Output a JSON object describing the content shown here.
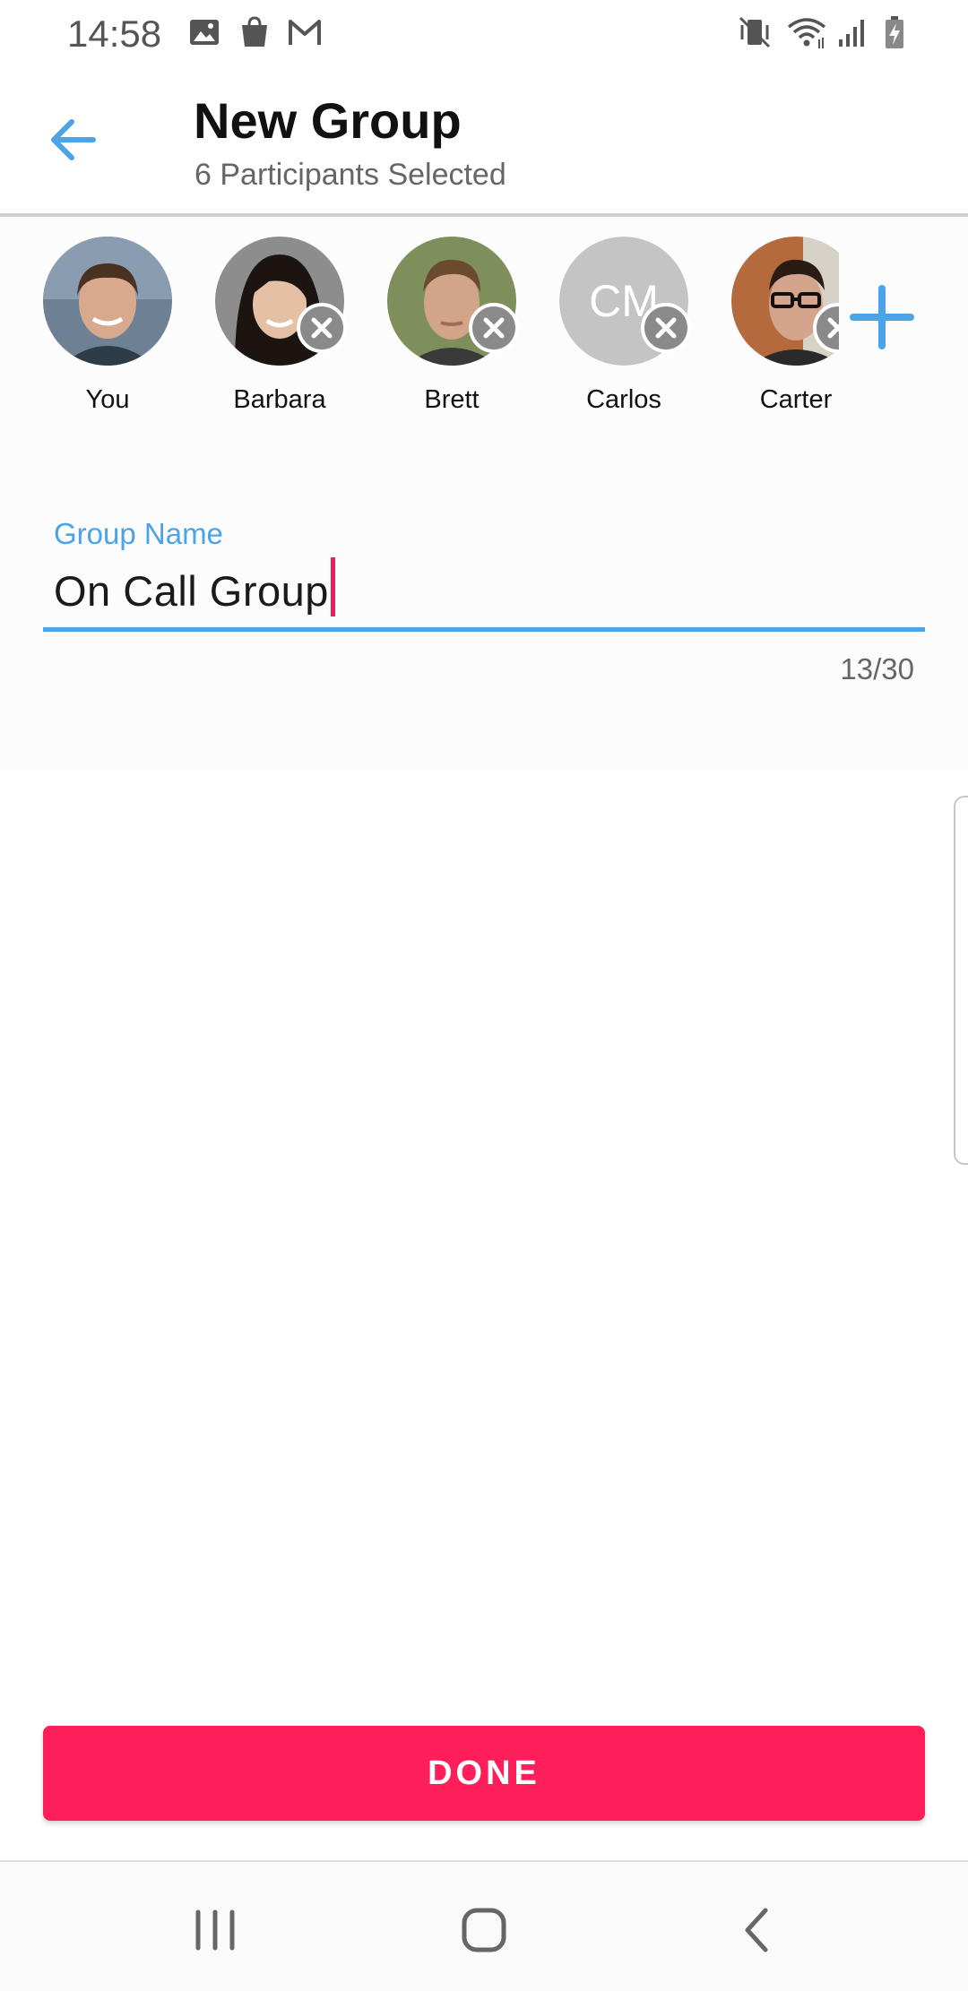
{
  "status_bar": {
    "time": "14:58",
    "left_icons": [
      "gallery-icon",
      "shopping-bag-icon",
      "gmail-icon"
    ],
    "right_icons": [
      "vibrate-mute-icon",
      "wifi-icon",
      "signal-icon",
      "battery-charging-icon"
    ]
  },
  "header": {
    "title": "New Group",
    "subtitle": "6 Participants Selected",
    "back_icon": "arrow-left-icon"
  },
  "participants": [
    {
      "name": "You",
      "removable": false
    },
    {
      "name": "Barbara",
      "removable": true
    },
    {
      "name": "Brett",
      "removable": true
    },
    {
      "name": "Carlos",
      "initials": "CM",
      "removable": true
    },
    {
      "name": "Carter",
      "removable": true
    }
  ],
  "add_participant_icon": "plus-icon",
  "group_name": {
    "label": "Group Name",
    "value": "On Call Group",
    "counter": "13/30"
  },
  "done_button": {
    "label": "DONE"
  },
  "colors": {
    "accent": "#4ba3e8",
    "done": "#fe1f5a",
    "caret": "#ea1f5c"
  },
  "nav_bar": {
    "buttons": [
      "recent-apps-icon",
      "home-icon",
      "back-icon"
    ]
  }
}
